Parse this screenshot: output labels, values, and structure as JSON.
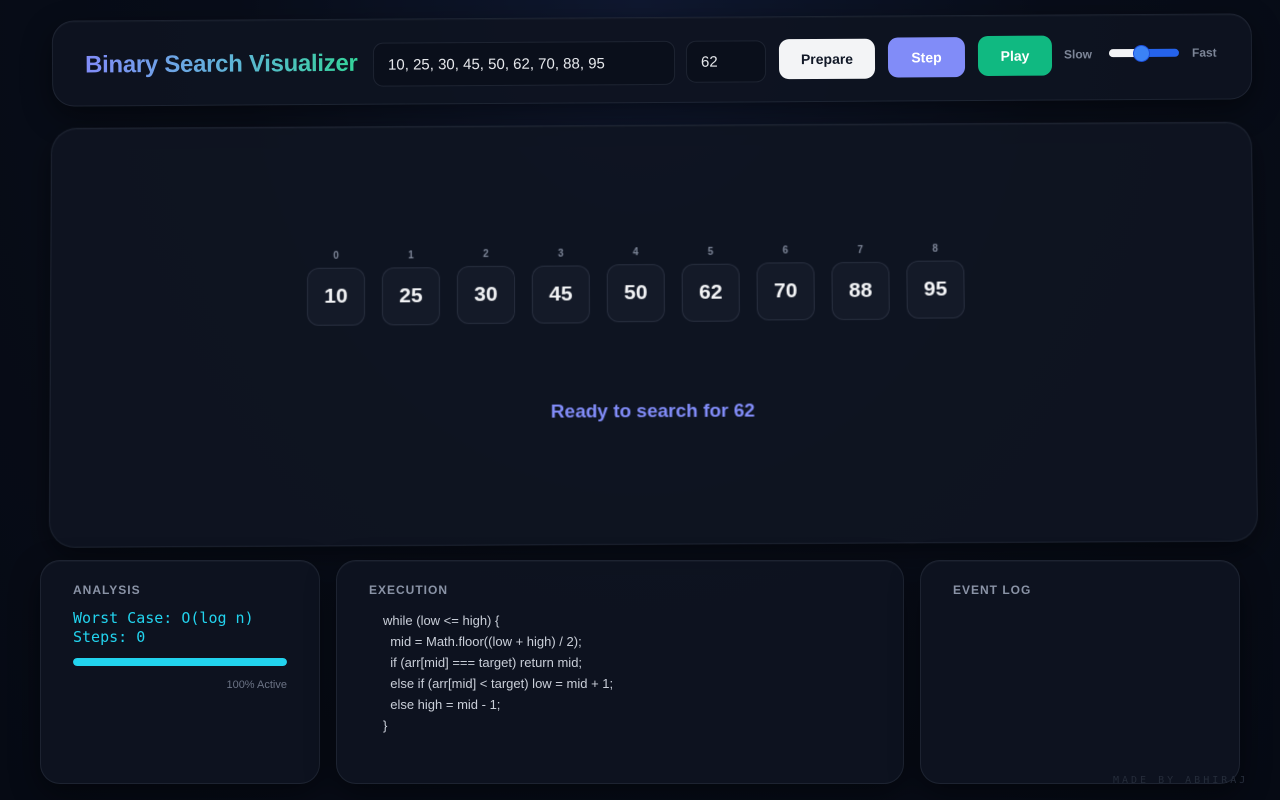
{
  "header": {
    "title": "Binary Search Visualizer",
    "array_input_value": "10, 25, 30, 45, 50, 62, 70, 88, 95",
    "target_input_value": "62",
    "prepare_label": "Prepare",
    "step_label": "Step",
    "play_label": "Play",
    "speed_slow_label": "Slow",
    "speed_fast_label": "Fast",
    "speed_level": 0.45
  },
  "stage": {
    "cells": [
      {
        "index": "0",
        "value": "10"
      },
      {
        "index": "1",
        "value": "25"
      },
      {
        "index": "2",
        "value": "30"
      },
      {
        "index": "3",
        "value": "45"
      },
      {
        "index": "4",
        "value": "50"
      },
      {
        "index": "5",
        "value": "62"
      },
      {
        "index": "6",
        "value": "70"
      },
      {
        "index": "7",
        "value": "88"
      },
      {
        "index": "8",
        "value": "95"
      }
    ],
    "status": "Ready to search for 62"
  },
  "analysis": {
    "title": "ANALYSIS",
    "worst_case": "Worst Case: O(log n)",
    "steps": "Steps: 0",
    "progress_fraction": 1.0,
    "progress_label": "100% Active"
  },
  "execution": {
    "title": "EXECUTION",
    "code_lines": [
      "while (low <= high) {",
      "  mid = Math.floor((low + high) / 2);",
      "  if (arr[mid] === target) return mid;",
      "  else if (arr[mid] < target) low = mid + 1;",
      "  else high = mid - 1;",
      "}"
    ]
  },
  "event_log": {
    "title": "EVENT LOG"
  },
  "footer": "MADE BY ABHIRAJ",
  "colors": {
    "accent_indigo": "#818cf8",
    "accent_green": "#10b981",
    "accent_cyan": "#22d3ee"
  }
}
